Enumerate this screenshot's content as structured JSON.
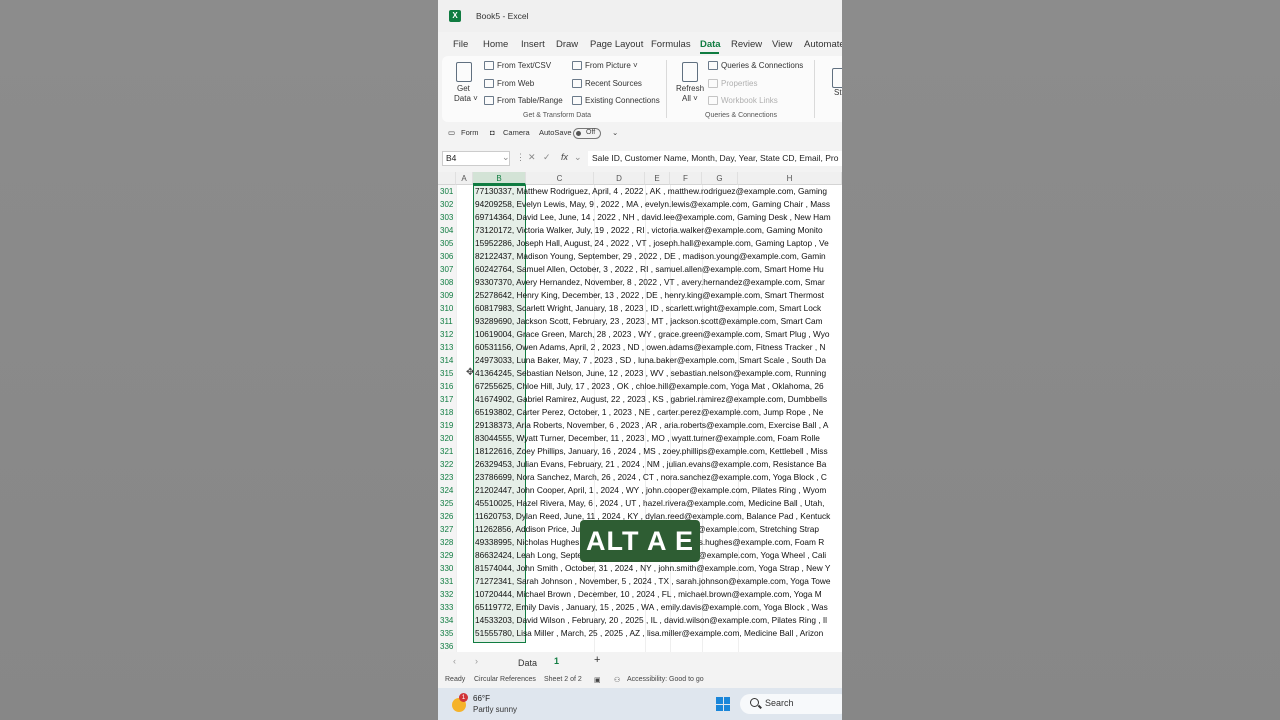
{
  "window": {
    "title": "Book5 - Excel",
    "app_icon": "X"
  },
  "menu": [
    "File",
    "Home",
    "Insert",
    "Draw",
    "Page Layout",
    "Formulas",
    "Data",
    "Review",
    "View",
    "Automate"
  ],
  "menu_active": "Data",
  "ribbon": {
    "get_data": {
      "line1": "Get",
      "line2": "Data ˅"
    },
    "from_text_csv": "From Text/CSV",
    "from_web": "From Web",
    "from_table_range": "From Table/Range",
    "from_picture": "From Picture ˅",
    "recent_sources": "Recent Sources",
    "existing_connections": "Existing Connections",
    "group_get_transform": "Get & Transform Data",
    "refresh": {
      "line1": "Refresh",
      "line2": "All ˅"
    },
    "queries_connections": "Queries & Connections",
    "properties": "Properties",
    "workbook_links": "Workbook Links",
    "group_queries": "Queries & Connections",
    "stock": "St"
  },
  "quick_access": {
    "form": "Form",
    "camera": "Camera",
    "autosave": "AutoSave",
    "autosave_state": "Off"
  },
  "formula_bar": {
    "name_box": "B4",
    "content": "Sale ID, Customer Name, Month, Day, Year, State CD, Email, Pro"
  },
  "columns": [
    "A",
    "B",
    "C",
    "D",
    "E",
    "F",
    "G",
    "H"
  ],
  "selected_column": "B",
  "rows": [
    {
      "n": "301",
      "text": "77130337, Matthew Rodriguez, April, 4 , 2022 , AK , matthew.rodriguez@example.com, Gaming"
    },
    {
      "n": "302",
      "text": "94209258, Evelyn Lewis, May, 9 , 2022 , MA , evelyn.lewis@example.com, Gaming Chair , Mass"
    },
    {
      "n": "303",
      "text": "69714364, David Lee, June, 14 , 2022 , NH , david.lee@example.com, Gaming Desk , New Ham"
    },
    {
      "n": "304",
      "text": "73120172, Victoria Walker, July, 19 , 2022 , RI , victoria.walker@example.com, Gaming Monito"
    },
    {
      "n": "305",
      "text": "15952286, Joseph Hall, August, 24 , 2022 , VT , joseph.hall@example.com, Gaming Laptop , Ve"
    },
    {
      "n": "306",
      "text": "82122437, Madison Young, September, 29 , 2022 , DE , madison.young@example.com, Gamin"
    },
    {
      "n": "307",
      "text": "60242764, Samuel Allen, October, 3 , 2022 , RI , samuel.allen@example.com, Smart Home Hu"
    },
    {
      "n": "308",
      "text": "93307370, Avery Hernandez, November, 8 , 2022 , VT , avery.hernandez@example.com, Smar"
    },
    {
      "n": "309",
      "text": "25278642, Henry King, December, 13 , 2022 , DE , henry.king@example.com, Smart Thermost"
    },
    {
      "n": "310",
      "text": "60817983, Scarlett Wright, January, 18 , 2023 , ID , scarlett.wright@example.com, Smart Lock"
    },
    {
      "n": "311",
      "text": "93289690, Jackson Scott, February, 23 , 2023 , MT , jackson.scott@example.com, Smart Cam"
    },
    {
      "n": "312",
      "text": "10619004, Grace Green, March, 28 , 2023 , WY , grace.green@example.com, Smart Plug , Wyo"
    },
    {
      "n": "313",
      "text": "60531156, Owen Adams, April, 2 , 2023 , ND , owen.adams@example.com, Fitness Tracker , N"
    },
    {
      "n": "314",
      "text": "24973033, Luna Baker, May, 7 , 2023 , SD , luna.baker@example.com, Smart Scale , South Da"
    },
    {
      "n": "315",
      "text": "41364245, Sebastian Nelson, June, 12 , 2023 , WV , sebastian.nelson@example.com, Running"
    },
    {
      "n": "316",
      "text": "67255625, Chloe Hill, July, 17 , 2023 , OK , chloe.hill@example.com, Yoga Mat , Oklahoma, 26"
    },
    {
      "n": "317",
      "text": "41674902, Gabriel Ramirez, August, 22 , 2023 , KS , gabriel.ramirez@example.com, Dumbbells"
    },
    {
      "n": "318",
      "text": "65193802, Carter Perez, October, 1 , 2023 , NE , carter.perez@example.com, Jump Rope , Ne"
    },
    {
      "n": "319",
      "text": "29138373, Aria Roberts, November, 6 , 2023 , AR , aria.roberts@example.com, Exercise Ball , A"
    },
    {
      "n": "320",
      "text": "83044555, Wyatt Turner, December, 11 , 2023 , MO , wyatt.turner@example.com, Foam Rolle"
    },
    {
      "n": "321",
      "text": "18122616, Zoey Phillips, January, 16 , 2024 , MS , zoey.phillips@example.com, Kettlebell , Miss"
    },
    {
      "n": "322",
      "text": "26329453, Julian Evans, February, 21 , 2024 , NM , julian.evans@example.com, Resistance Ba"
    },
    {
      "n": "323",
      "text": "23786699, Nora Sanchez, March, 26 , 2024 , CT , nora.sanchez@example.com, Yoga Block , C"
    },
    {
      "n": "324",
      "text": "21202447, John Cooper, April, 1 , 2024 , WY , john.cooper@example.com, Pilates Ring , Wyom"
    },
    {
      "n": "325",
      "text": "45510025, Hazel Rivera, May, 6 , 2024 , UT , hazel.rivera@example.com, Medicine Ball , Utah,"
    },
    {
      "n": "326",
      "text": "11620753, Dylan Reed, June, 11 , 2024 , KY , dylan.reed@example.com, Balance Pad , Kentuck"
    },
    {
      "n": "327",
      "text": "11262856, Addison Price, July, 16 , 2024 , AL , addison.price@example.com, Stretching Strap"
    },
    {
      "n": "328",
      "text": "49338995, Nicholas Hughes, August, 21 , 2024 , AZ , nicholas.hughes@example.com, Foam R"
    },
    {
      "n": "329",
      "text": "86632424, Leah Long, September, 26 , 2024 , CA , leah.long@example.com, Yoga Wheel , Cali"
    },
    {
      "n": "330",
      "text": "81574044, John Smith , October, 31 , 2024 , NY , john.smith@example.com, Yoga Strap , New Y"
    },
    {
      "n": "331",
      "text": "71272341, Sarah Johnson , November, 5 , 2024 , TX , sarah.johnson@example.com, Yoga Towe"
    },
    {
      "n": "332",
      "text": "10720444, Michael Brown , December, 10 , 2024 , FL , michael.brown@example.com, Yoga M"
    },
    {
      "n": "333",
      "text": "65119772, Emily Davis , January, 15 , 2025 , WA , emily.davis@example.com, Yoga Block , Was"
    },
    {
      "n": "334",
      "text": "14533203, David Wilson , February, 20 , 2025 , IL , david.wilson@example.com, Pilates Ring , Il"
    },
    {
      "n": "335",
      "text": "51555780, Lisa Miller , March, 25 , 2025 , AZ , lisa.miller@example.com, Medicine Ball , Arizon"
    },
    {
      "n": "336",
      "text": ""
    }
  ],
  "sheets": {
    "data": "Data",
    "current": "1",
    "add": "+",
    "prev": "‹",
    "next": "›"
  },
  "status": {
    "ready": "Ready",
    "circular": "Circular References",
    "sheet": "Sheet 2 of 2",
    "accessibility": "Accessibility: Good to go"
  },
  "taskbar": {
    "temp": "66°F",
    "condition": "Partly sunny",
    "badge": "1",
    "search": "Search"
  },
  "overlay": "ALT A E",
  "colors": {
    "excel_green": "#107c41",
    "selection_fill": "#e6efe8",
    "overlay_bg": "#2e5d33"
  }
}
